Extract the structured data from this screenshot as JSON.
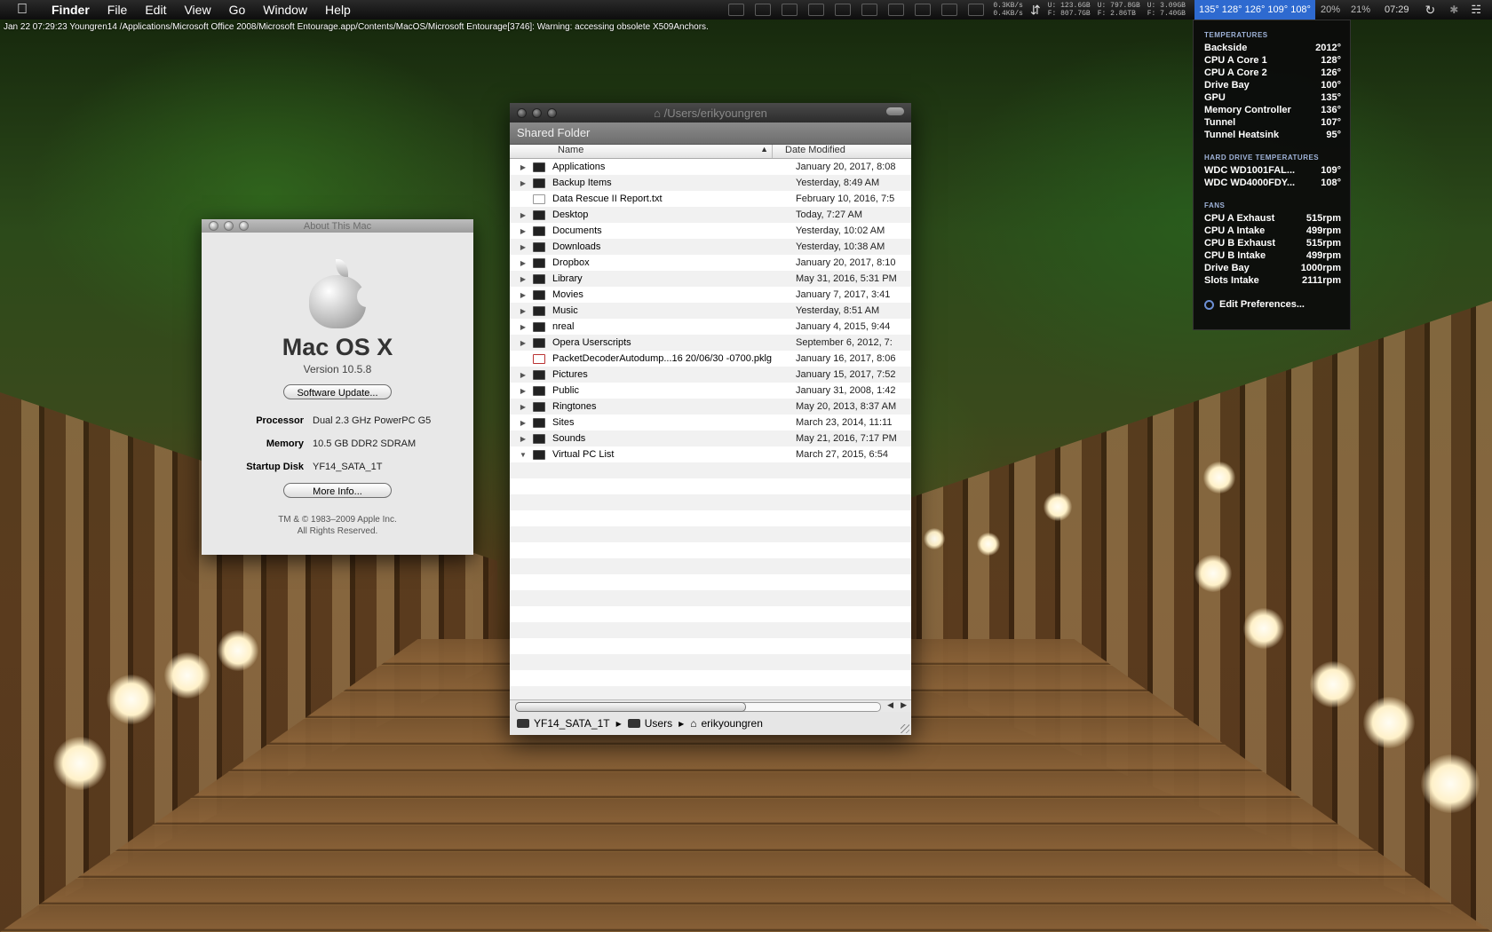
{
  "menubar": {
    "app": "Finder",
    "items": [
      "File",
      "Edit",
      "View",
      "Go",
      "Window",
      "Help"
    ],
    "net_up": "0.3KB/s",
    "net_down": "0.4KB/s",
    "disk1_u": "U: 123.6GB",
    "disk1_f": "F: 807.7GB",
    "disk2_u": "U: 797.8GB",
    "disk2_f": "F: 2.86TB",
    "disk3_u": "U: 3.09GB",
    "disk3_f": "F: 7.40GB",
    "temps": "135° 128° 126° 109° 108°",
    "cpu1": "20%",
    "cpu2": "21%",
    "clock": "07:29"
  },
  "console": "Jan 22 07:29:23 Youngren14 /Applications/Microsoft Office 2008/Microsoft Entourage.app/Contents/MacOS/Microsoft Entourage[3746]: Warning: accessing obsolete X509Anchors.",
  "about": {
    "title": "About This Mac",
    "os_name": "Mac OS X",
    "version": "Version 10.5.8",
    "software_update": "Software Update...",
    "processor_label": "Processor",
    "processor": "Dual 2.3 GHz PowerPC G5",
    "memory_label": "Memory",
    "memory": "10.5 GB DDR2 SDRAM",
    "startup_label": "Startup Disk",
    "startup": "YF14_SATA_1T",
    "more_info": "More Info...",
    "copyright1": "TM & © 1983–2009 Apple Inc.",
    "copyright2": "All Rights Reserved."
  },
  "finder": {
    "path_title": "/Users/erikyoungren",
    "folder_title": "Shared Folder",
    "col_name": "Name",
    "col_date": "Date Modified",
    "rows": [
      {
        "name": "Applications",
        "date": "January 20, 2017, 8:08",
        "icon": "folder-icon",
        "tri": "▶"
      },
      {
        "name": "Backup Items",
        "date": "Yesterday, 8:49 AM",
        "icon": "folder-icon",
        "tri": "▶"
      },
      {
        "name": "Data Rescue II Report.txt",
        "date": "February 10, 2016, 7:5",
        "icon": "document-icon",
        "tri": ""
      },
      {
        "name": "Desktop",
        "date": "Today, 7:27 AM",
        "icon": "folder-icon",
        "tri": "▶"
      },
      {
        "name": "Documents",
        "date": "Yesterday, 10:02 AM",
        "icon": "folder-icon",
        "tri": "▶"
      },
      {
        "name": "Downloads",
        "date": "Yesterday, 10:38 AM",
        "icon": "folder-icon",
        "tri": "▶"
      },
      {
        "name": "Dropbox",
        "date": "January 20, 2017, 8:10",
        "icon": "folder-icon",
        "tri": "▶"
      },
      {
        "name": "Library",
        "date": "May 31, 2016, 5:31 PM",
        "icon": "folder-icon",
        "tri": "▶"
      },
      {
        "name": "Movies",
        "date": "January 7, 2017, 3:41",
        "icon": "folder-icon",
        "tri": "▶"
      },
      {
        "name": "Music",
        "date": "Yesterday, 8:51 AM",
        "icon": "folder-icon",
        "tri": "▶"
      },
      {
        "name": "nreal",
        "date": "January 4, 2015, 9:44",
        "icon": "folder-icon",
        "tri": "▶"
      },
      {
        "name": "Opera Userscripts",
        "date": "September 6, 2012, 7:",
        "icon": "folder-icon",
        "tri": "▶"
      },
      {
        "name": "PacketDecoderAutodump...16 20/06/30 -0700.pklg",
        "date": "January 16, 2017, 8:06",
        "icon": "package-icon",
        "tri": ""
      },
      {
        "name": "Pictures",
        "date": "January 15, 2017, 7:52",
        "icon": "folder-icon",
        "tri": "▶"
      },
      {
        "name": "Public",
        "date": "January 31, 2008, 1:42",
        "icon": "folder-icon",
        "tri": "▶"
      },
      {
        "name": "Ringtones",
        "date": "May 20, 2013, 8:37 AM",
        "icon": "folder-icon",
        "tri": "▶"
      },
      {
        "name": "Sites",
        "date": "March 23, 2014, 11:11",
        "icon": "folder-icon",
        "tri": "▶"
      },
      {
        "name": "Sounds",
        "date": "May 21, 2016, 7:17 PM",
        "icon": "folder-icon",
        "tri": "▶"
      },
      {
        "name": "Virtual PC List",
        "date": "March 27, 2015, 6:54",
        "icon": "folder-icon",
        "tri": "▼"
      }
    ],
    "pathbar": [
      "YF14_SATA_1T",
      "Users",
      "erikyoungren"
    ]
  },
  "temps_menu": {
    "temps_header": "TEMPERATURES",
    "temps": [
      {
        "label": "Backside",
        "value": "2012°"
      },
      {
        "label": "CPU A Core 1",
        "value": "128°"
      },
      {
        "label": "CPU A Core 2",
        "value": "126°"
      },
      {
        "label": "Drive Bay",
        "value": "100°"
      },
      {
        "label": "GPU",
        "value": "135°"
      },
      {
        "label": "Memory Controller",
        "value": "136°"
      },
      {
        "label": "Tunnel",
        "value": "107°"
      },
      {
        "label": "Tunnel Heatsink",
        "value": "95°"
      }
    ],
    "hd_header": "HARD DRIVE TEMPERATURES",
    "hd": [
      {
        "label": "WDC WD1001FAL...",
        "value": "109°"
      },
      {
        "label": "WDC WD4000FDY...",
        "value": "108°"
      }
    ],
    "fans_header": "FANS",
    "fans": [
      {
        "label": "CPU A Exhaust",
        "value": "515rpm"
      },
      {
        "label": "CPU A Intake",
        "value": "499rpm"
      },
      {
        "label": "CPU B Exhaust",
        "value": "515rpm"
      },
      {
        "label": "CPU B Intake",
        "value": "499rpm"
      },
      {
        "label": "Drive Bay",
        "value": "1000rpm"
      },
      {
        "label": "Slots Intake",
        "value": "2111rpm"
      }
    ],
    "prefs": "Edit Preferences..."
  }
}
